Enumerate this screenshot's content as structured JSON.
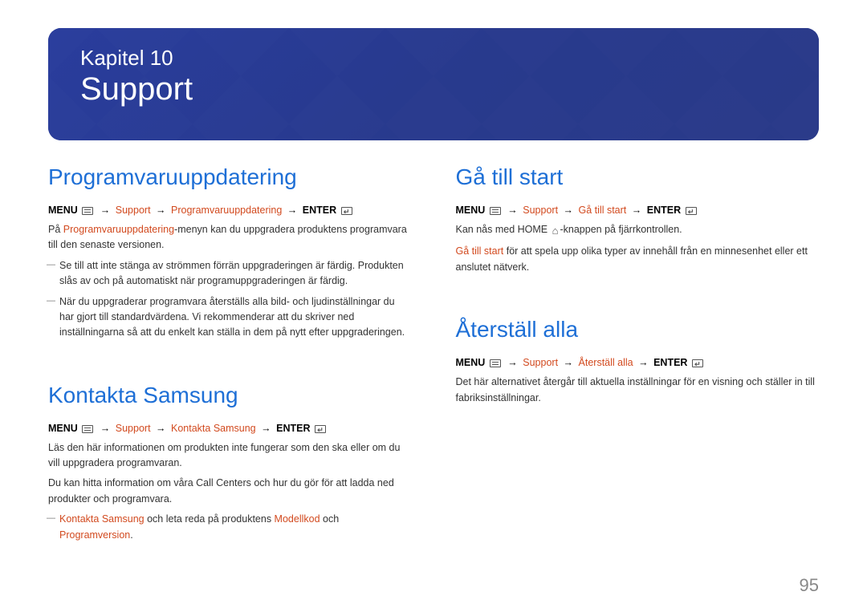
{
  "chapter": {
    "line": "Kapitel 10",
    "title": "Support"
  },
  "page_number": "95",
  "nav_common": {
    "menu": "MENU",
    "arrow": "→",
    "enter": "ENTER",
    "support": "Support"
  },
  "left": {
    "s1": {
      "heading": "Programvaruuppdatering",
      "nav_item": "Programvaruuppdatering",
      "p1_a": "På ",
      "p1_hl": "Programvaruuppdatering",
      "p1_b": "-menyn kan du uppgradera produktens programvara till den senaste versionen.",
      "note1": "Se till att inte stänga av strömmen förrän uppgraderingen är färdig. Produkten slås av och på automatiskt när programuppgraderingen är färdig.",
      "note2": "När du uppgraderar programvara återställs alla bild- och ljudinställningar du har gjort till standardvärdena. Vi rekommenderar att du skriver ned inställningarna så att du enkelt kan ställa in dem på nytt efter uppgraderingen."
    },
    "s2": {
      "heading": "Kontakta Samsung",
      "nav_item": "Kontakta Samsung",
      "p1": "Läs den här informationen om produkten inte fungerar som den ska eller om du vill uppgradera programvaran.",
      "p2": "Du kan hitta information om våra Call Centers och hur du gör för att ladda ned produkter och programvara.",
      "note1_a": "Kontakta Samsung",
      "note1_b": " och leta reda på produktens ",
      "note1_hl2": "Modellkod",
      "note1_c": " och ",
      "note1_hl3": "Programversion",
      "note1_d": "."
    }
  },
  "right": {
    "s1": {
      "heading": "Gå till start",
      "nav_item": "Gå till start",
      "p1_a": "Kan nås med ",
      "p1_b": "HOME",
      "p1_c": "-knappen på fjärrkontrollen.",
      "p2_hl": "Gå till start",
      "p2_b": " för att spela upp olika typer av innehåll från en minnesenhet eller ett anslutet nätverk."
    },
    "s2": {
      "heading": "Återställ alla",
      "nav_item": "Återställ alla",
      "p1": "Det här alternativet återgår till aktuella inställningar för en visning och ställer in till fabriksinställningar."
    }
  }
}
